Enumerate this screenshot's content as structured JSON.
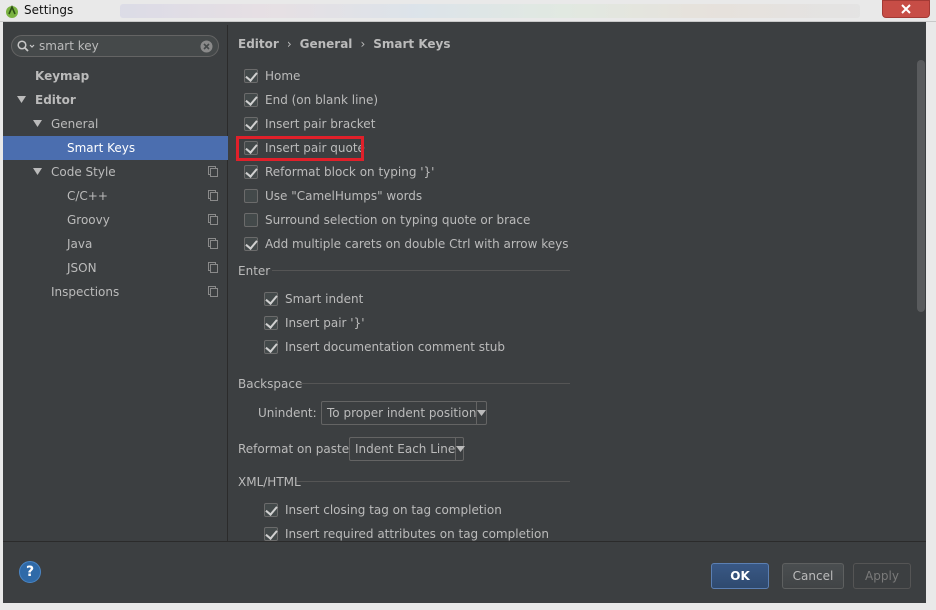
{
  "window": {
    "title": "Settings"
  },
  "search": {
    "value": "smart key",
    "placeholder": ""
  },
  "sidebar": {
    "items": [
      {
        "label": "Keymap"
      },
      {
        "label": "Editor"
      },
      {
        "label": "General"
      },
      {
        "label": "Smart Keys"
      },
      {
        "label": "Code Style"
      },
      {
        "label": "C/C++"
      },
      {
        "label": "Groovy"
      },
      {
        "label": "Java"
      },
      {
        "label": "JSON"
      },
      {
        "label": "Inspections"
      }
    ]
  },
  "breadcrumb": {
    "items": [
      "Editor",
      "General",
      "Smart Keys"
    ],
    "separator": "›"
  },
  "options": [
    {
      "label": "Home",
      "checked": true
    },
    {
      "label": "End (on blank line)",
      "checked": true
    },
    {
      "label": "Insert pair bracket",
      "checked": true
    },
    {
      "label": "Insert pair quote",
      "checked": true
    },
    {
      "label": "Reformat block on typing '}'",
      "checked": true
    },
    {
      "label": "Use \"CamelHumps\" words",
      "checked": false
    },
    {
      "label": "Surround selection on typing quote or brace",
      "checked": false
    },
    {
      "label": "Add multiple carets on double Ctrl with arrow keys",
      "checked": true
    }
  ],
  "enter": {
    "title": "Enter",
    "options": [
      {
        "label": "Smart indent",
        "checked": true
      },
      {
        "label": "Insert pair '}'",
        "checked": true
      },
      {
        "label": "Insert documentation comment stub",
        "checked": true
      }
    ]
  },
  "backspace": {
    "title": "Backspace",
    "unindent_label": "Unindent:",
    "unindent_value": "To proper indent position"
  },
  "reformat": {
    "label": "Reformat on paste:",
    "value": "Indent Each Line"
  },
  "xml": {
    "title": "XML/HTML",
    "options": [
      {
        "label": "Insert closing tag on tag completion",
        "checked": true
      },
      {
        "label": "Insert required attributes on tag completion",
        "checked": true
      }
    ]
  },
  "buttons": {
    "help": "?",
    "ok": "OK",
    "cancel": "Cancel",
    "apply": "Apply"
  },
  "colors": {
    "selection": "#4b6eaf",
    "highlight_border": "#e0202a",
    "primary_button": "#2f4a6f"
  }
}
